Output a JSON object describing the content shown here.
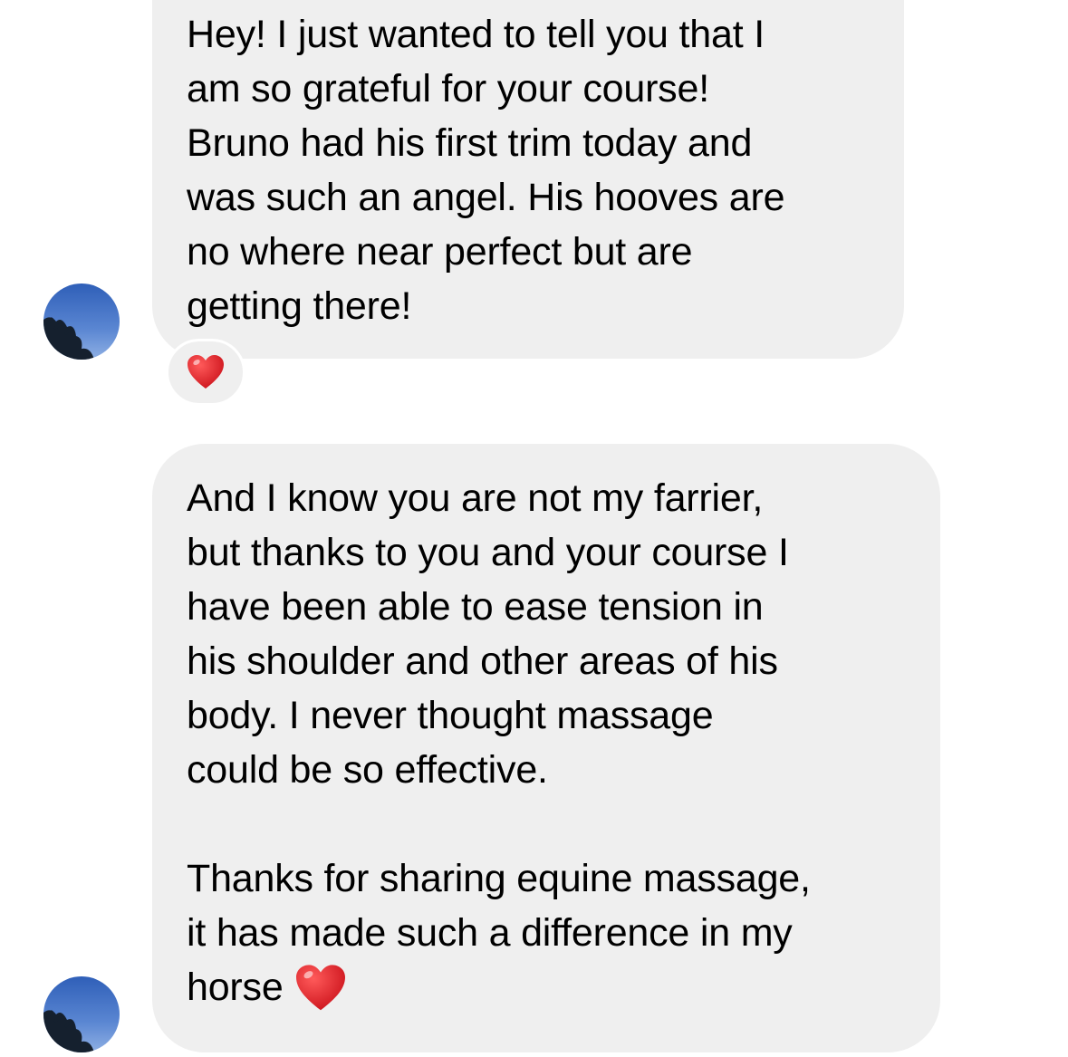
{
  "messages": [
    {
      "text": "Hey! I just wanted to tell you that I\nam so grateful for your course!\nBruno had his first trim today and\nwas such an angel. His hooves are\nno where near perfect but are\ngetting there!",
      "reaction": "heart-icon"
    },
    {
      "paragraph1": "And I know you are not my farrier,\nbut thanks to you and your course I\nhave been able to ease tension in\nhis shoulder and other areas of his\nbody. I never thought massage\ncould be so effective.",
      "paragraph2": "Thanks for sharing equine massage,\nit has made such a difference in my\nhorse",
      "trailing_emoji": "heart-icon"
    }
  ],
  "colors": {
    "bubble": "#efefef",
    "heart": "#e0141e",
    "avatar_sky": "#3f6fc0"
  }
}
